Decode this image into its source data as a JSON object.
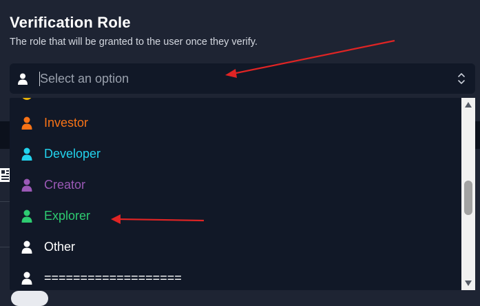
{
  "header": {
    "title": "Verification Role",
    "description": "The role that will be granted to the user once they verify."
  },
  "select": {
    "placeholder": "Select an option",
    "icon": "user-icon",
    "toggle_icon": "chevron-up-down-icon"
  },
  "dropdown": {
    "options": [
      {
        "label": "Investor",
        "color": "#f97316",
        "icon": "user-icon"
      },
      {
        "label": "Developer",
        "color": "#22d3ee",
        "icon": "user-icon"
      },
      {
        "label": "Creator",
        "color": "#9b59b6",
        "icon": "user-icon"
      },
      {
        "label": "Explorer",
        "color": "#2ecc71",
        "icon": "user-icon"
      },
      {
        "label": "Other",
        "color": "#ffffff",
        "icon": "user-icon"
      },
      {
        "label": "===================",
        "color": "#ffffff",
        "icon": "user-icon"
      }
    ],
    "partial_option_color": "#eab308"
  },
  "colors": {
    "background": "#1e2433",
    "input_background": "#111827",
    "annotation_arrow": "#e02424"
  }
}
